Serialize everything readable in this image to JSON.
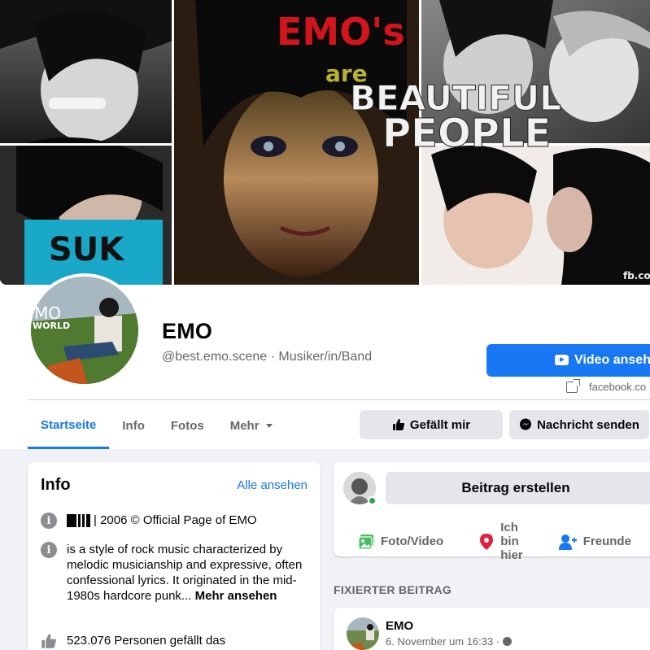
{
  "cover": {
    "text_line1": "EMO's",
    "text_line2": "are",
    "text_line3": "BEAUTIFUL",
    "text_line4": "PEOPLE",
    "watermark": "fb.co"
  },
  "avatar": {
    "text1": "MO",
    "text2": "WORLD"
  },
  "profile": {
    "name": "EMO",
    "handle": "@best.emo.scene · Musiker/in/Band"
  },
  "actions": {
    "video_label": "Video ansehen",
    "link_text": "facebook.co",
    "like_label": "Gefällt mir",
    "message_label": "Nachricht senden"
  },
  "tabs": [
    {
      "label": "Startseite",
      "active": true
    },
    {
      "label": "Info"
    },
    {
      "label": "Fotos"
    },
    {
      "label": "Mehr"
    }
  ],
  "info_card": {
    "title": "Info",
    "see_all": "Alle ansehen",
    "row1": "| 2006 © Official Page of EMO",
    "row2": "is a style of rock music characterized by melodic musicianship and expressive, often confessional lyrics. It originated in the mid-1980s hardcore punk...",
    "row2_more": "Mehr ansehen",
    "row3": "523.076 Personen gefällt das"
  },
  "composer": {
    "create_label": "Beitrag erstellen",
    "photo_video": "Foto/Video",
    "checkin": "Ich bin hier",
    "friends": "Freunde"
  },
  "pinned": {
    "label": "FIXIERTER BEITRAG",
    "author": "EMO",
    "time": "6. November um 16:33 ·"
  },
  "colors": {
    "accent": "#1877f2",
    "online": "#31a24c",
    "checkin_red": "#e41e3f",
    "photo_green": "#45bd62"
  }
}
